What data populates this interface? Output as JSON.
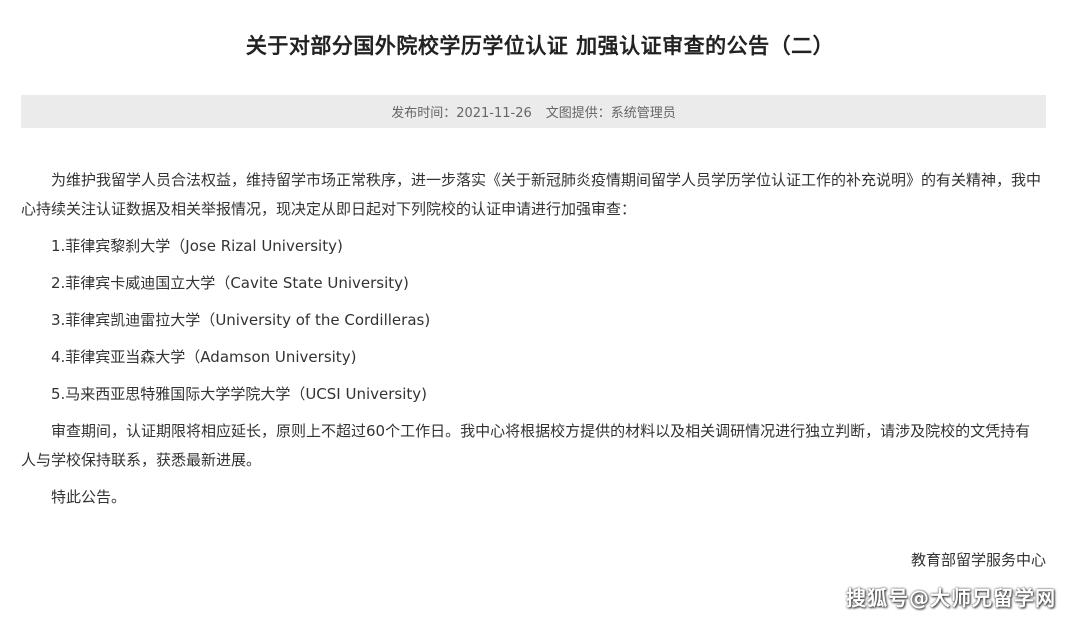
{
  "article": {
    "title": "关于对部分国外院校学历学位认证 加强认证审查的公告（二）",
    "meta": {
      "publish_time": "发布时间：2021-11-26",
      "image_provider": "文图提供：系统管理员"
    },
    "intro": "为维护我留学人员合法权益，维持留学市场正常秩序，进一步落实《关于新冠肺炎疫情期间留学人员学历学位认证工作的补充说明》的有关精神，我中心持续关注认证数据及相关举报情况，现决定从即日起对下列院校的认证申请进行加强审查：",
    "schools": [
      "1.菲律宾黎刹大学（Jose Rizal University)",
      "2.菲律宾卡威迪国立大学（Cavite State University)",
      "3.菲律宾凯迪雷拉大学（University of the Cordilleras)",
      "4.菲律宾亚当森大学（Adamson University)",
      "5.马来西亚思特雅国际大学学院大学（UCSI University)"
    ],
    "review_note": "审查期间，认证期限将相应延长，原则上不超过60个工作日。我中心将根据校方提供的材料以及相关调研情况进行独立判断，请涉及院校的文凭持有人与学校保持联系，获悉最新进展。",
    "closing": "特此公告。",
    "signature": "教育部留学服务中心"
  },
  "watermark": "搜狐号@大师兄留学网"
}
